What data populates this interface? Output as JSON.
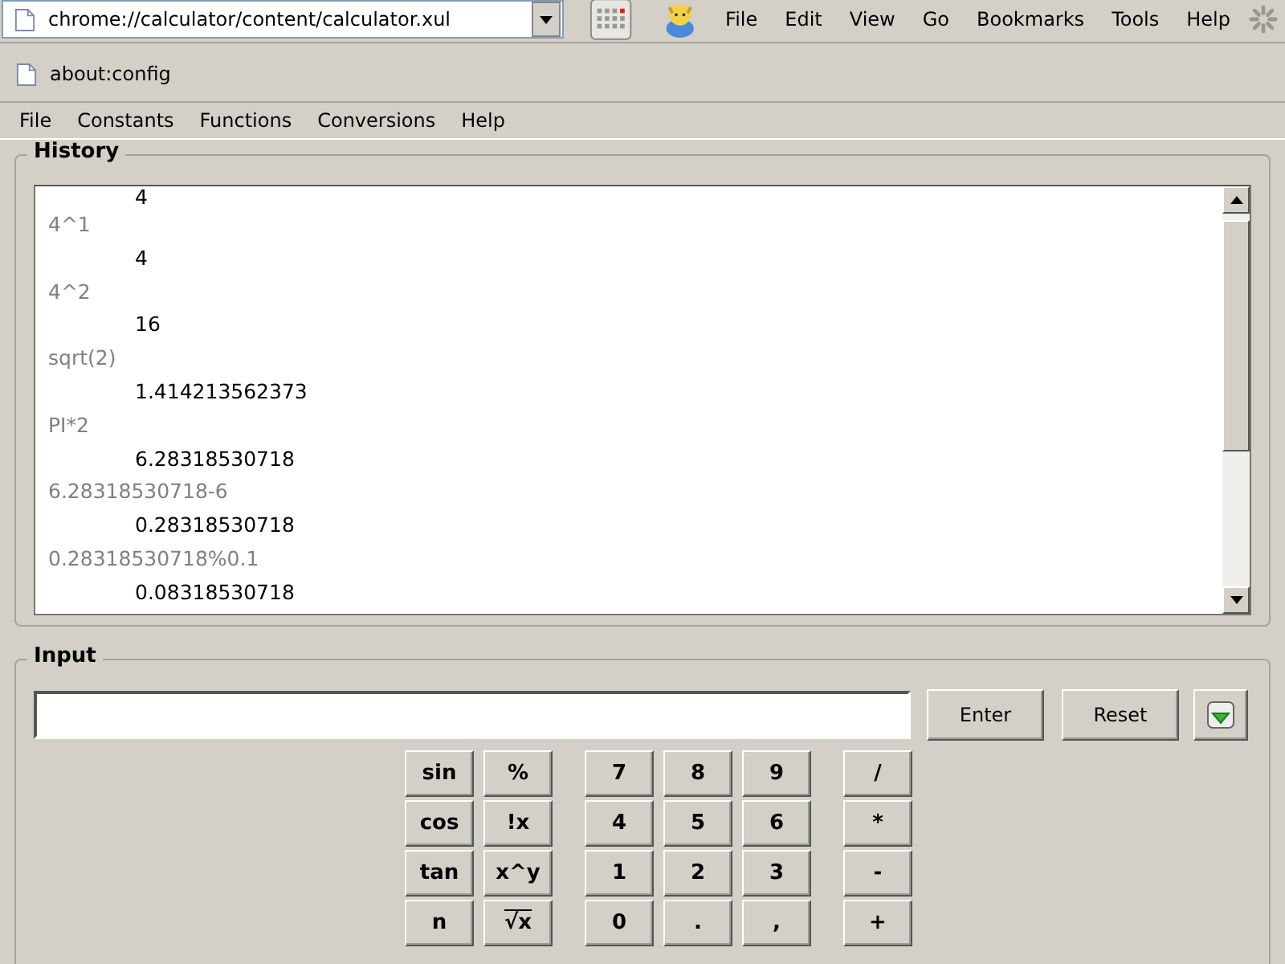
{
  "toolbar": {
    "address": "chrome://calculator/content/calculator.xul",
    "menu": [
      {
        "label": "File"
      },
      {
        "label": "Edit"
      },
      {
        "label": "View"
      },
      {
        "label": "Go"
      },
      {
        "label": "Bookmarks"
      },
      {
        "label": "Tools"
      },
      {
        "label": "Help"
      }
    ]
  },
  "tab": {
    "label": "about:config"
  },
  "app_menu": [
    {
      "label": "File"
    },
    {
      "label": "Constants"
    },
    {
      "label": "Functions"
    },
    {
      "label": "Conversions"
    },
    {
      "label": "Help"
    }
  ],
  "history": {
    "title": "History",
    "entries": [
      {
        "kind": "result",
        "text": "4"
      },
      {
        "kind": "expression",
        "text": "4^1"
      },
      {
        "kind": "result",
        "text": "4"
      },
      {
        "kind": "expression",
        "text": "4^2"
      },
      {
        "kind": "result",
        "text": "16"
      },
      {
        "kind": "expression",
        "text": "sqrt(2)"
      },
      {
        "kind": "result",
        "text": "1.414213562373"
      },
      {
        "kind": "expression",
        "text": "PI*2"
      },
      {
        "kind": "result",
        "text": "6.28318530718"
      },
      {
        "kind": "expression",
        "text": "6.28318530718-6"
      },
      {
        "kind": "result",
        "text": "0.28318530718"
      },
      {
        "kind": "expression",
        "text": "0.28318530718%0.1"
      },
      {
        "kind": "result",
        "text": "0.08318530718"
      }
    ]
  },
  "input": {
    "title": "Input",
    "buttons": [
      {
        "label": "Enter"
      },
      {
        "label": "Reset"
      }
    ]
  },
  "keypad": [
    [
      "sin",
      "%",
      "7",
      "8",
      "9",
      "/"
    ],
    [
      "cos",
      "!x",
      "4",
      "5",
      "6",
      "*"
    ],
    [
      "tan",
      "x^y",
      "1",
      "2",
      "3",
      "-"
    ],
    [
      "n",
      "√x",
      "0",
      ".",
      ",",
      "+"
    ]
  ]
}
